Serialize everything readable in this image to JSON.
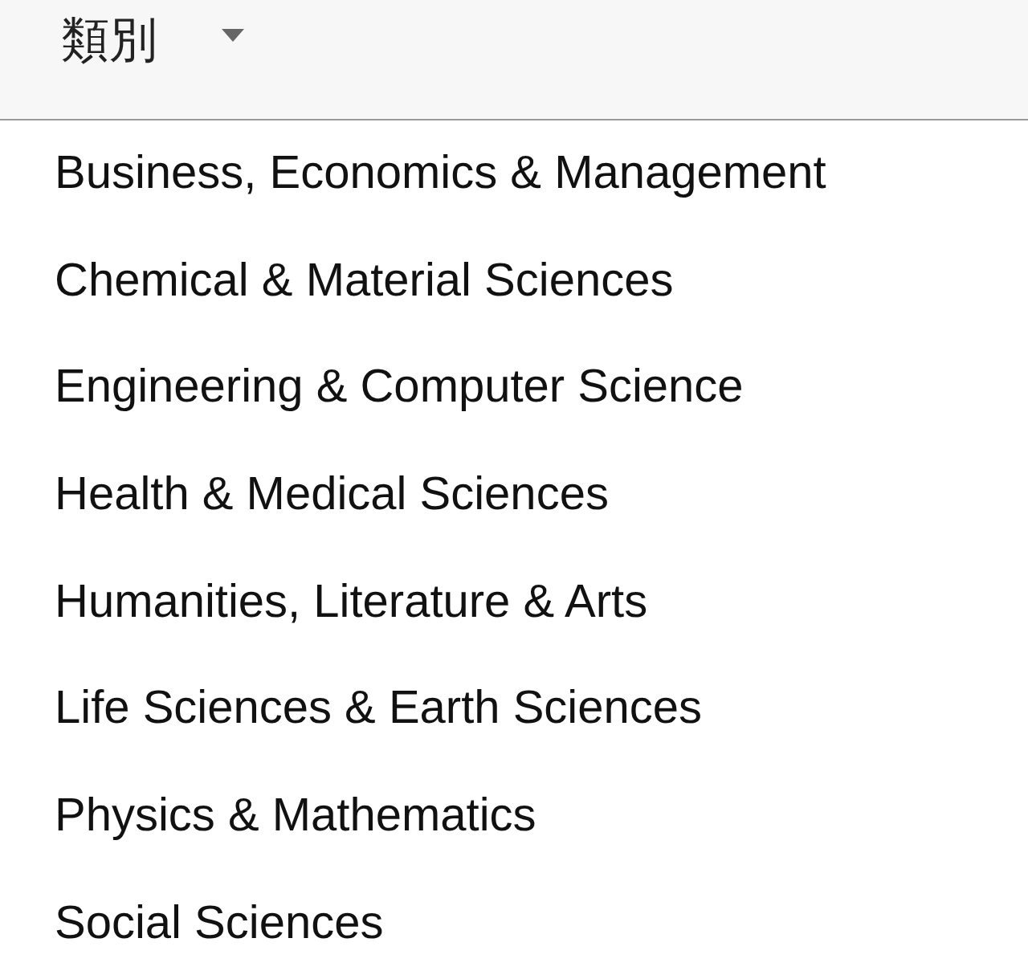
{
  "dropdown": {
    "label": "類別",
    "expanded": true
  },
  "menu": {
    "items": [
      {
        "label": "Business, Economics & Management"
      },
      {
        "label": "Chemical & Material Sciences"
      },
      {
        "label": "Engineering & Computer Science"
      },
      {
        "label": "Health & Medical Sciences"
      },
      {
        "label": "Humanities, Literature & Arts"
      },
      {
        "label": "Life Sciences & Earth Sciences"
      },
      {
        "label": "Physics & Mathematics"
      },
      {
        "label": "Social Sciences"
      }
    ]
  }
}
